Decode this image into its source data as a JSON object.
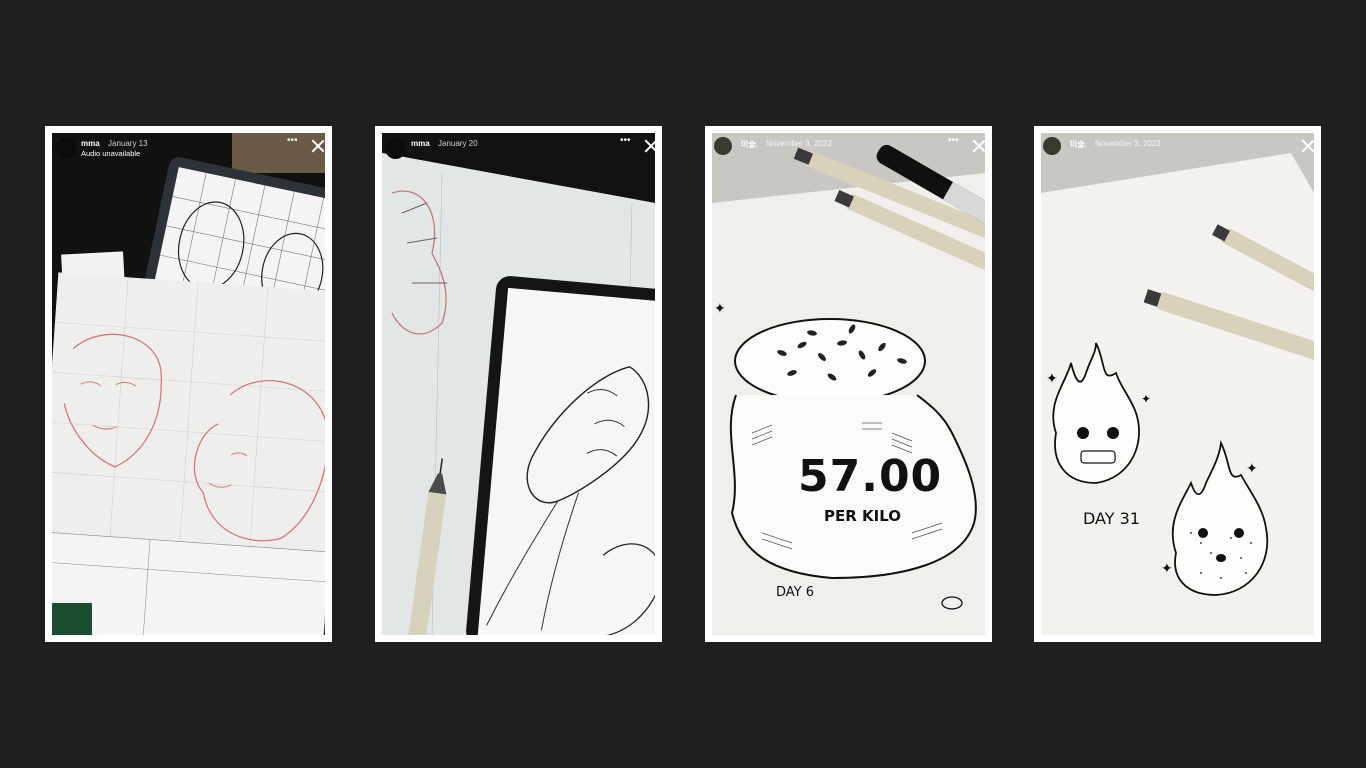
{
  "stories": [
    {
      "username": "mma",
      "date": "January 13",
      "subtitle": "Audio unavailable"
    },
    {
      "username": "mma",
      "date": "January 20"
    },
    {
      "username": "미술.",
      "date": "November 3, 2023",
      "caption_price": "57.00",
      "caption_unit": "PER KILO",
      "caption_day": "DAY 6"
    },
    {
      "username": "미술.",
      "date": "November 3, 2023",
      "caption_day": "DAY 31"
    }
  ],
  "icons": {
    "more": "more-options-icon",
    "close": "close-icon"
  },
  "colors": {
    "background": "#1f1f1f",
    "card": "#ffffff",
    "header_text": "#ffffff"
  }
}
